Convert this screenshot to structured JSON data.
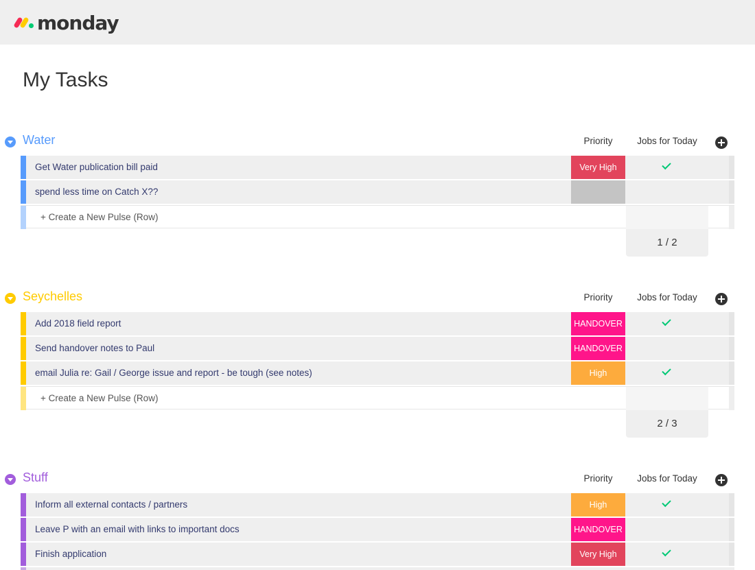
{
  "app": {
    "logo_text": "monday"
  },
  "page": {
    "title": "My Tasks"
  },
  "columns": {
    "priority": "Priority",
    "jobs": "Jobs for Today"
  },
  "new_row_label": "+ Create a New Pulse (Row)",
  "colors": {
    "very_high": "#e2445c",
    "handover": "#ff158a",
    "high": "#fdab3d",
    "empty": "#c4c4c4",
    "check": "#00c875"
  },
  "groups": [
    {
      "name": "Water",
      "color": "#579bfc",
      "light_color": "#b3d2fd",
      "summary": "1 / 2",
      "rows": [
        {
          "name": "Get Water publication bill paid",
          "priority": "Very High",
          "priority_color": "#e2445c",
          "jobs_done": true
        },
        {
          "name": "spend less time on Catch X??",
          "priority": "",
          "priority_color": "#c4c4c4",
          "jobs_done": false
        }
      ]
    },
    {
      "name": "Seychelles",
      "color": "#ffcb00",
      "light_color": "#ffe580",
      "summary": "2 / 3",
      "rows": [
        {
          "name": "Add 2018 field report",
          "priority": "HANDOVER",
          "priority_color": "#ff158a",
          "jobs_done": true
        },
        {
          "name": "Send handover notes to Paul",
          "priority": "HANDOVER",
          "priority_color": "#ff158a",
          "jobs_done": false
        },
        {
          "name": "email Julia re: Gail / George issue and report - be tough (see notes)",
          "priority": "High",
          "priority_color": "#fdab3d",
          "jobs_done": true
        }
      ]
    },
    {
      "name": "Stuff",
      "color": "#a25ddc",
      "light_color": "#d5b3f0",
      "summary": "",
      "rows": [
        {
          "name": "Inform all external contacts / partners",
          "priority": "High",
          "priority_color": "#fdab3d",
          "jobs_done": true
        },
        {
          "name": "Leave P with an email with links to important docs",
          "priority": "HANDOVER",
          "priority_color": "#ff158a",
          "jobs_done": false
        },
        {
          "name": "Finish application",
          "priority": "Very High",
          "priority_color": "#e2445c",
          "jobs_done": true
        }
      ]
    }
  ]
}
